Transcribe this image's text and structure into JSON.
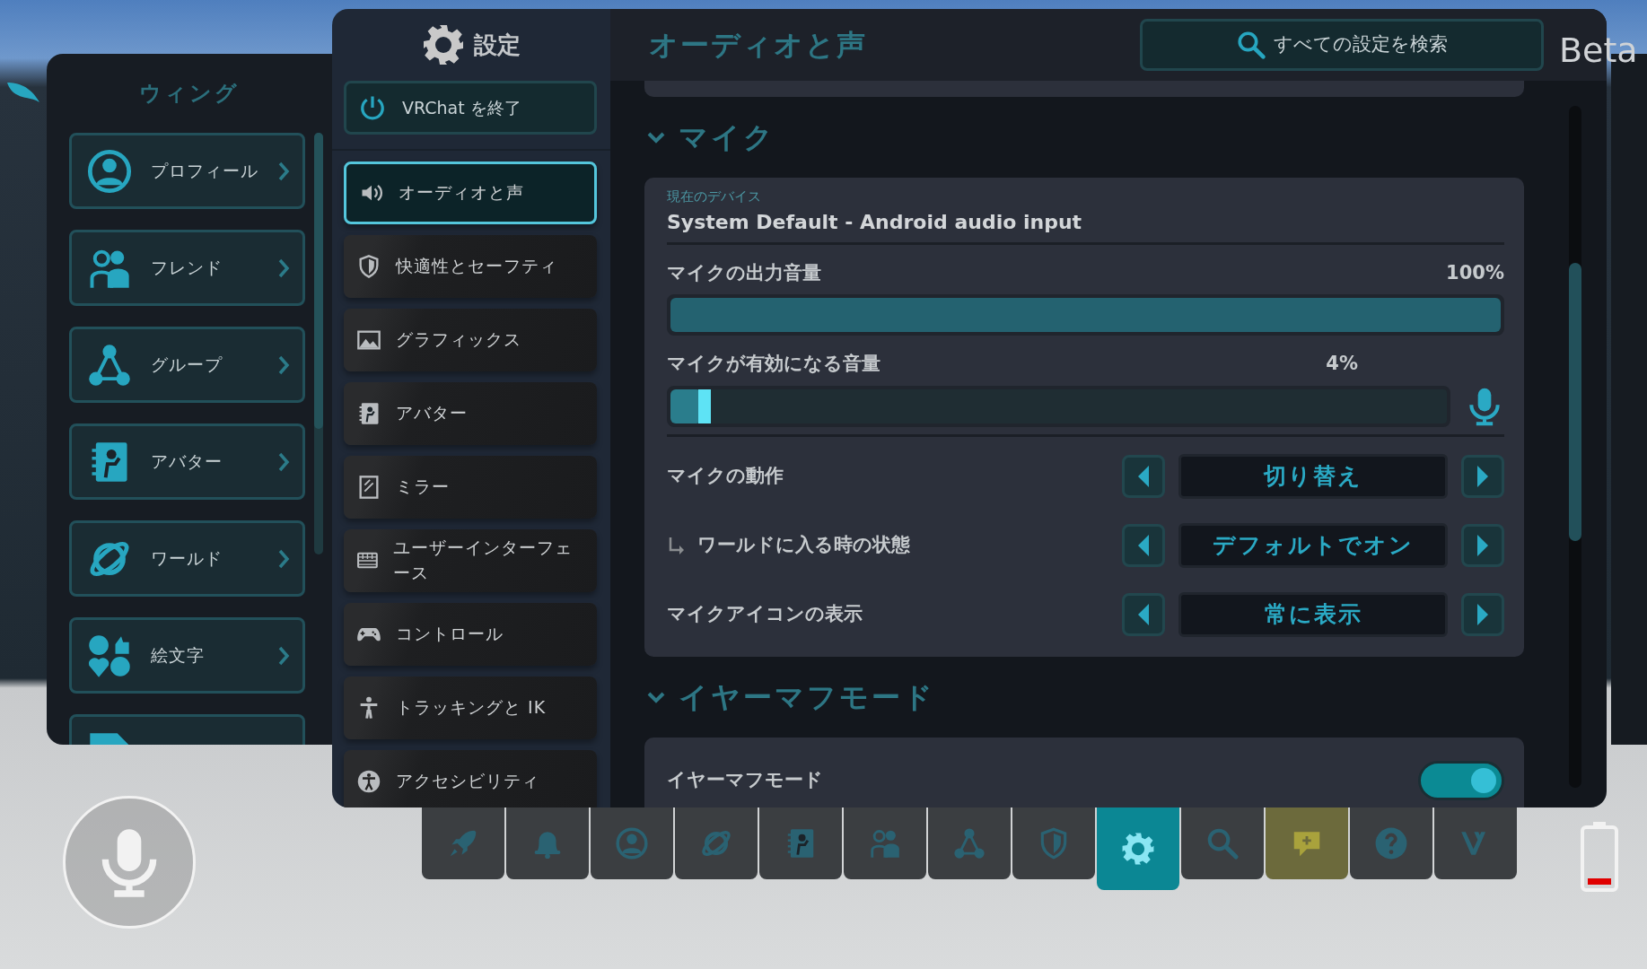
{
  "wing": {
    "title": "ウィング",
    "items": [
      {
        "label": "プロフィール",
        "kind": "profile"
      },
      {
        "label": "フレンド",
        "kind": "friends"
      },
      {
        "label": "グループ",
        "kind": "group"
      },
      {
        "label": "アバター",
        "kind": "avatar"
      },
      {
        "label": "ワールド",
        "kind": "world"
      },
      {
        "label": "絵文字",
        "kind": "emoji"
      },
      {
        "kind": "sticker"
      }
    ]
  },
  "settings": {
    "title": "設定",
    "quit_button": "VRChat を終了",
    "nav": [
      {
        "label": "オーディオと声",
        "kind": "audio",
        "selected": true
      },
      {
        "label": "快適性とセーフティ",
        "kind": "shield",
        "selected": false
      },
      {
        "label": "グラフィックス",
        "kind": "graphics",
        "selected": false
      },
      {
        "label": "アバター",
        "kind": "avatar",
        "selected": false
      },
      {
        "label": "ミラー",
        "kind": "mirror",
        "selected": false
      },
      {
        "label": "ユーザーインターフェース",
        "kind": "ui",
        "selected": false
      },
      {
        "label": "コントロール",
        "kind": "controller",
        "selected": false
      },
      {
        "label": "トラッキングと IK",
        "kind": "tracking",
        "selected": false
      },
      {
        "label": "アクセシビリティ",
        "kind": "accessibility",
        "selected": false
      }
    ]
  },
  "content": {
    "title": "オーディオと声",
    "search": "すべての設定を検索",
    "badge": "Beta",
    "sections": [
      {
        "title": "マイク",
        "expanded": true,
        "rows": [
          {
            "kind": "device",
            "caption": "現在のデバイス",
            "value": "System Default - Android audio input"
          },
          {
            "kind": "slider",
            "label": "マイクの出力音量",
            "reading": "100%",
            "level": 1
          },
          {
            "kind": "threshold",
            "label": "マイクが有効になる音量",
            "reading": "4%",
            "level": 0.04
          },
          {
            "kind": "selector",
            "label": "マイクの動作",
            "value": "切り替え",
            "indented": false
          },
          {
            "kind": "selector",
            "label": "ワールドに入る時の状態",
            "value": "デフォルトでオン",
            "indented": true
          },
          {
            "kind": "selector",
            "label": "マイクアイコンの表示",
            "value": "常に表示",
            "indented": false
          }
        ]
      },
      {
        "title": "イヤーマフモード",
        "expanded": true,
        "rows": [
          {
            "kind": "toggle",
            "label": "イヤーマフモード",
            "on": true
          }
        ]
      }
    ]
  },
  "toolbar": [
    {
      "kind": "rocket",
      "selected": false,
      "highlighted": false
    },
    {
      "kind": "bell",
      "selected": false,
      "highlighted": false
    },
    {
      "kind": "profile",
      "selected": false,
      "highlighted": false
    },
    {
      "kind": "world",
      "selected": false,
      "highlighted": false
    },
    {
      "kind": "avatar",
      "selected": false,
      "highlighted": false
    },
    {
      "kind": "friends",
      "selected": false,
      "highlighted": false
    },
    {
      "kind": "group",
      "selected": false,
      "highlighted": false
    },
    {
      "kind": "shield",
      "selected": false,
      "highlighted": false
    },
    {
      "kind": "gear",
      "selected": true,
      "highlighted": false
    },
    {
      "kind": "search",
      "selected": false,
      "highlighted": false
    },
    {
      "kind": "chat",
      "selected": false,
      "highlighted": true
    },
    {
      "kind": "help",
      "selected": false,
      "highlighted": false
    },
    {
      "kind": "vrc",
      "selected": false,
      "highlighted": false
    }
  ]
}
